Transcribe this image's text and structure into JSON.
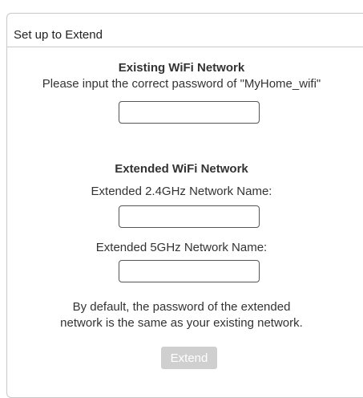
{
  "header": {
    "title": "Set up to Extend"
  },
  "existing": {
    "heading": "Existing WiFi Network",
    "instruction": "Please input the correct password of \"MyHome_wifi\"",
    "password_value": ""
  },
  "extended": {
    "heading": "Extended WiFi Network",
    "label_24": "Extended 2.4GHz Network Name:",
    "value_24": "",
    "label_5": "Extended 5GHz Network Name:",
    "value_5": ""
  },
  "note": {
    "line1": "By default, the password of the extended",
    "line2": "network is the same as your existing network."
  },
  "actions": {
    "extend_label": "Extend",
    "extend_enabled": false
  }
}
